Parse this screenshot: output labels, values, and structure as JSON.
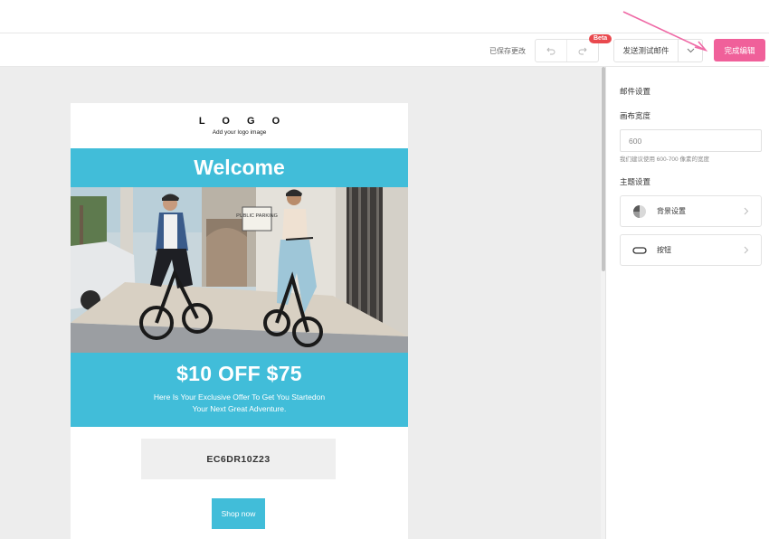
{
  "toolbar": {
    "saved_status": "已保存更改",
    "beta_badge": "Beta",
    "send_test_label": "发送测试邮件",
    "finish_label": "完成编辑"
  },
  "email": {
    "logo_text": "L O G O",
    "logo_subtext": "Add your logo image",
    "welcome_heading": "Welcome",
    "offer_title": "$10 OFF $75",
    "offer_line1": "Here Is Your Exclusive Offer To Get You Startedon",
    "offer_line2": "Your Next Great Adventure.",
    "coupon_code": "EC6DR10Z23",
    "shop_button": "Shop now",
    "photo_sign_text": "PUBLIC PARKING"
  },
  "panel": {
    "title": "邮件设置",
    "canvas_width_label": "画布宽度",
    "canvas_width_value": "600",
    "canvas_width_hint": "我们建议使用 600-700 像素的宽度",
    "theme_label": "主题设置",
    "rows": [
      {
        "label": "背景设置",
        "icon": "pie-chart-icon"
      },
      {
        "label": "按钮",
        "icon": "button-pill-icon"
      }
    ]
  },
  "colors": {
    "accent_pink": "#f0609a",
    "email_teal": "#41bdd9",
    "beta_red": "#e9494e",
    "canvas_gray": "#ededed"
  }
}
